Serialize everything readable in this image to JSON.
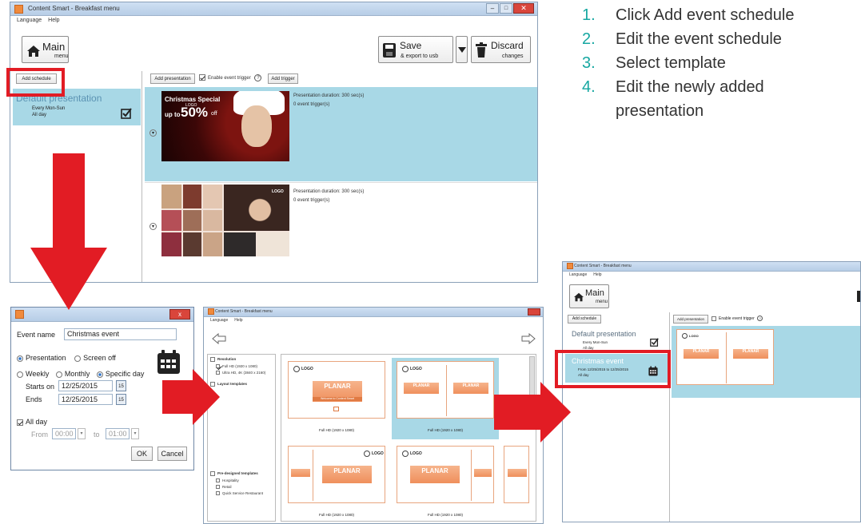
{
  "steps": [
    {
      "num": "1.",
      "text": "Click Add event schedule"
    },
    {
      "num": "2.",
      "text": "Edit the event schedule"
    },
    {
      "num": "3.",
      "text": "Select template"
    },
    {
      "num": "4.",
      "text": "Edit the newly added presentation"
    }
  ],
  "main_window": {
    "title": "Content Smart - Breakfast menu",
    "menu": [
      "Language",
      "Help"
    ],
    "main_label": "Main",
    "main_sub": "menu",
    "save_label": "Save",
    "save_sub": "& export to usb",
    "discard_label": "Discard",
    "discard_sub": "changes",
    "add_schedule": "Add schedule",
    "add_presentation": "Add presentation",
    "enable_trigger": "Enable event trigger",
    "help_mark": "?",
    "add_trigger": "Add trigger",
    "schedule": {
      "name": "Default presentation",
      "days": "Every Mon-Sun",
      "time": "All day"
    },
    "presentations": [
      {
        "duration": "Presentation duration: 300 sec(s)",
        "triggers": "0 event trigger(s)",
        "promo_title": "Christmas Special",
        "promo_up": "up to",
        "promo_pct": "50%",
        "promo_off": "off",
        "logo": "LOGO"
      },
      {
        "duration": "Presentation duration: 300 sec(s)",
        "triggers": "0 event trigger(s)",
        "logo": "LOGO"
      }
    ]
  },
  "dialog": {
    "close": "x",
    "event_name_label": "Event name",
    "event_name_value": "Christmas event",
    "type_options": [
      "Presentation",
      "Screen off"
    ],
    "freq_options": [
      "Weekly",
      "Monthly",
      "Specific day"
    ],
    "starts_label": "Starts on",
    "starts_value": "12/25/2015",
    "ends_label": "Ends",
    "ends_value": "12/25/2015",
    "cal_day": "15",
    "all_day": "All day",
    "from_label": "From",
    "from_value": "00:00",
    "to_label": "to",
    "to_value": "01:00",
    "ok": "OK",
    "cancel": "Cancel"
  },
  "template_window": {
    "title": "Content Smart - Breakfast menu",
    "menu": [
      "Language",
      "Help"
    ],
    "resolution_header": "Resolution",
    "resolutions": [
      "Full HD (1920 x 1080)",
      "Ultra HD, 4K (3840 x 2160)"
    ],
    "layout_header": "Layout templates",
    "pre_header": "Pre-designed templates",
    "pre_items": [
      "Hospitality",
      "Retail",
      "Quick Service Restaurant"
    ],
    "brand": "PLANAR",
    "welcome": "Welcome to Content Smart",
    "logo": "LOGO",
    "caption": "Full HD (1920 x 1080)"
  },
  "result_window": {
    "title": "Content Smart - Breakfast menu",
    "menu": [
      "Language",
      "Help"
    ],
    "main_label": "Main",
    "main_sub": "menu",
    "add_schedule": "Add schedule",
    "add_presentation": "Add presentation",
    "enable_trigger": "Enable event trigger",
    "help_mark": "?",
    "default": {
      "name": "Default presentation",
      "days": "Every Mon-Sun",
      "time": "All day"
    },
    "event": {
      "name": "Christmas event",
      "days": "From 12/25/2015 to 12/25/2015",
      "time": "All day"
    },
    "brand": "PLANAR",
    "logo": "LOGO"
  },
  "colors": {
    "accent": "#16a7a1",
    "red": "#e21c24",
    "selection": "#a8d8e6",
    "orange": "#f08a3c"
  }
}
